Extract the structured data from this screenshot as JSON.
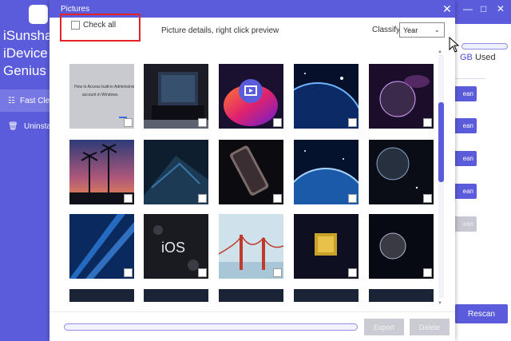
{
  "app": {
    "brand_lines": [
      "iSunsha",
      "iDevice",
      "Genius"
    ],
    "nav": [
      {
        "label": "Fast Cleanu",
        "icon": "broom-icon",
        "active": true
      },
      {
        "label": "Uninstall",
        "icon": "trash-icon",
        "active": false
      }
    ],
    "storage": {
      "gb": "GB",
      "used": "Used"
    },
    "clean_buttons": [
      "ean",
      "ean",
      "ean",
      "ean",
      "ean"
    ],
    "rescan_label": "Rescan",
    "accent_color": "#5b5cdb"
  },
  "dialog": {
    "title": "Pictures",
    "close_icon": "close-icon",
    "toolbar": {
      "check_all_label": "Check all",
      "details_text": "Picture details, right click preview",
      "classify_label": "Classify:",
      "classify_value": "Year"
    },
    "thumbnails": [
      {
        "row": 0,
        "col": 0,
        "subject": "dark-strip"
      },
      {
        "row": 0,
        "col": 1,
        "subject": "dark-strip"
      },
      {
        "row": 0,
        "col": 2,
        "subject": "dark-strip"
      },
      {
        "row": 0,
        "col": 3,
        "subject": "dark-strip"
      },
      {
        "row": 0,
        "col": 4,
        "subject": "dark-strip"
      },
      {
        "row": 1,
        "col": 0,
        "subject": "document-screenshot",
        "caption_lines": [
          "How to Access built-in Administrator",
          "account in Windows"
        ]
      },
      {
        "row": 1,
        "col": 1,
        "subject": "laptop-desk"
      },
      {
        "row": 1,
        "col": 2,
        "subject": "video-app-icon"
      },
      {
        "row": 1,
        "col": 3,
        "subject": "planet-horizon"
      },
      {
        "row": 1,
        "col": 4,
        "subject": "nebula-planet"
      },
      {
        "row": 2,
        "col": 0,
        "subject": "palm-sunset"
      },
      {
        "row": 2,
        "col": 1,
        "subject": "abstract-blue"
      },
      {
        "row": 2,
        "col": 2,
        "subject": "phone-dark"
      },
      {
        "row": 2,
        "col": 3,
        "subject": "earth-orbit"
      },
      {
        "row": 2,
        "col": 4,
        "subject": "planet-space"
      },
      {
        "row": 3,
        "col": 0,
        "subject": "blue-light-rays"
      },
      {
        "row": 3,
        "col": 1,
        "subject": "ios-logo",
        "caption": "iOS"
      },
      {
        "row": 3,
        "col": 2,
        "subject": "golden-gate-fog"
      },
      {
        "row": 3,
        "col": 3,
        "subject": "gold-chip"
      },
      {
        "row": 3,
        "col": 4,
        "subject": "planet-space-2"
      },
      {
        "row": 4,
        "col": 0,
        "subject": "partial"
      },
      {
        "row": 4,
        "col": 1,
        "subject": "partial"
      },
      {
        "row": 4,
        "col": 2,
        "subject": "partial"
      },
      {
        "row": 4,
        "col": 3,
        "subject": "partial"
      },
      {
        "row": 4,
        "col": 4,
        "subject": "partial"
      }
    ],
    "footer": {
      "export_label": "Export",
      "delete_label": "Delete"
    }
  }
}
